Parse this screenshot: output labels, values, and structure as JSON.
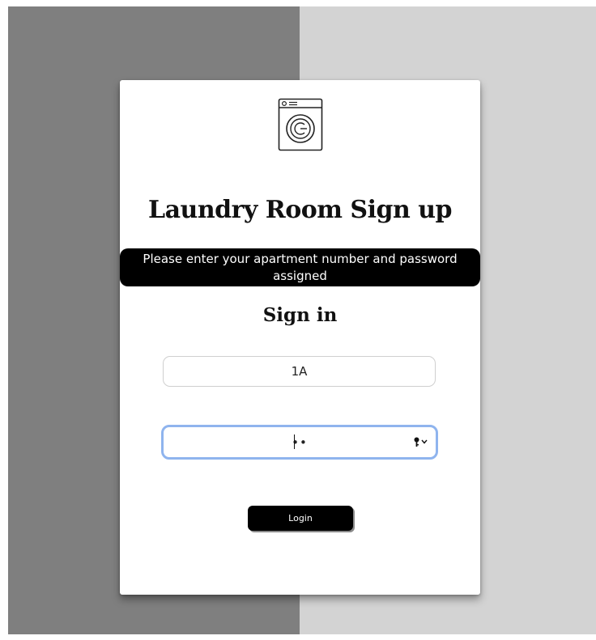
{
  "page": {
    "title": "Laundry Room Sign up",
    "instructions": "Please enter your apartment number and password assigned",
    "subtitle": "Sign in"
  },
  "form": {
    "apartment_value": "1A",
    "password_value": "••",
    "login_label": "Login"
  },
  "icons": {
    "logo": "washing-machine-icon",
    "password_manager": "key-icon"
  },
  "colors": {
    "left_panel": "#7f7f7f",
    "right_panel": "#d3d3d3",
    "focus_ring": "#8fb4ee",
    "banner": "#000000",
    "button": "#000000"
  }
}
